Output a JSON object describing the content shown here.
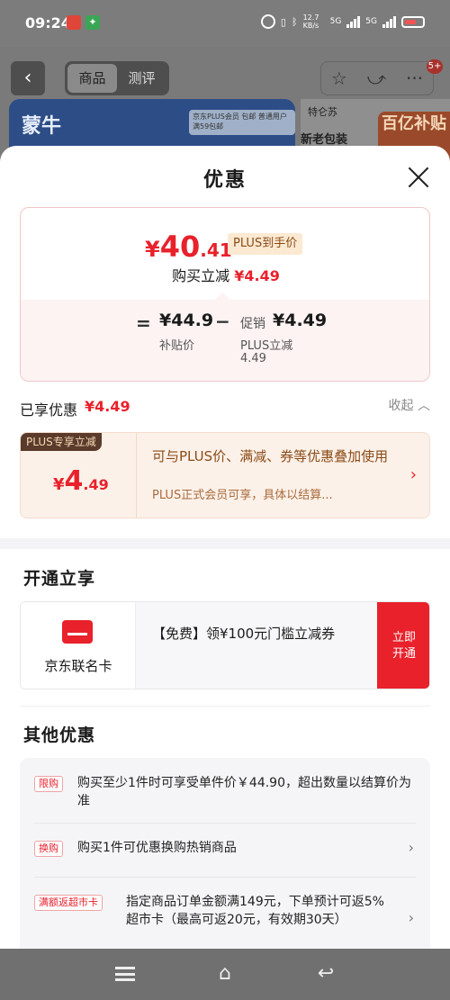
{
  "status_bar": {
    "time": "09:24",
    "net_speed": "12.7 KB/s",
    "sig1": "5G",
    "sig2": "5G"
  },
  "product_nav": {
    "back_icon": "chevron-left-icon",
    "tabs": [
      "商品",
      "测评"
    ],
    "badge": "5+",
    "banner_brand": "蒙牛",
    "banner_pill": "京东PLUS会员 包邮  普通用户 满59包邮",
    "banner_right_small": "特仑苏",
    "banner_right_text": "新老包装",
    "banner_right_badge": "百亿补贴"
  },
  "sheet": {
    "title": "优惠",
    "price_card": {
      "yen": "¥",
      "price_int": "40",
      "price_dec": ".41",
      "tag": "PLUS到手价",
      "sub_prefix": "购买立减",
      "sub_amount": "¥4.49",
      "eq": "=",
      "subsidy_price": "¥44.9",
      "subsidy_label": "补贴价",
      "minus": "−",
      "promo_prefix": "促销",
      "promo_amount": "¥4.49",
      "plus_reduce_label": "PLUS立减",
      "plus_reduce_value": "4.49"
    },
    "enjoyed": {
      "label": "已享优惠",
      "value": "¥4.49",
      "collapse": "收起"
    },
    "plus_card": {
      "badge": "PLUS专享立减",
      "yen": "¥",
      "amount_int": "4",
      "amount_dec": ".49",
      "desc": "可与PLUS价、满减、券等优惠叠加使用",
      "desc2": "PLUS正式会员可享，具体以结算...",
      "arrow": "›"
    },
    "open_section": {
      "title": "开通立享",
      "card_name": "京东联名卡",
      "card_desc": "【免费】领¥100元门槛立减券",
      "card_button": "立即开通"
    },
    "other_section": {
      "title": "其他优惠",
      "items": [
        {
          "tag": "限购",
          "text": "购买至少1件时可享受单件价￥44.90，超出数量以结算价为准",
          "arrow": ""
        },
        {
          "tag": "换购",
          "text": "购买1件可优惠换购热销商品",
          "arrow": "›"
        },
        {
          "tag": "满额返超市卡",
          "text": "指定商品订单金额满149元，下单预计可返5%超市卡（最高可返20元，有效期30天）",
          "arrow": "›"
        }
      ]
    }
  }
}
